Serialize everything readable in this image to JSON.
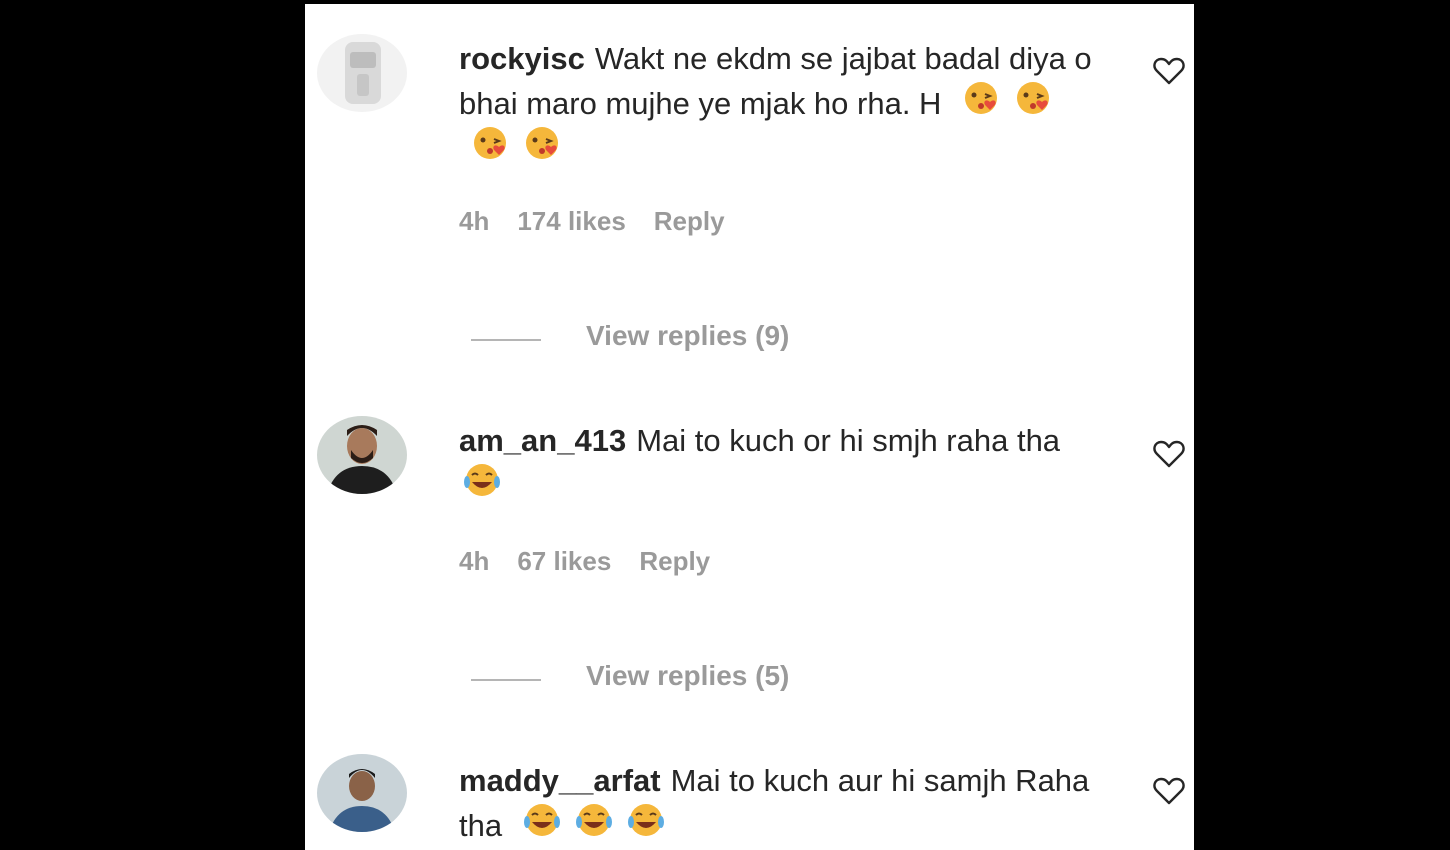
{
  "comments": [
    {
      "username": "rockyisc",
      "text": "Wakt ne ekdm se jajbat badal diya o bhai maro mujhe ye mjak ho rha. H",
      "emoji_count": 4,
      "emoji_type": "face-blowing-kiss",
      "time": "4h",
      "likes": "174 likes",
      "reply_label": "Reply",
      "view_replies": "View replies (9)"
    },
    {
      "username": "am_an_413",
      "text": "Mai to kuch or hi smjh raha tha",
      "emoji_count": 1,
      "emoji_type": "face-with-tears-of-joy",
      "time": "4h",
      "likes": "67 likes",
      "reply_label": "Reply",
      "view_replies": "View replies (5)"
    },
    {
      "username": "maddy__arfat",
      "text": "Mai to kuch aur hi samjh Raha tha",
      "emoji_count": 3,
      "emoji_type": "face-with-tears-of-joy"
    }
  ],
  "colors": {
    "background": "#000000",
    "panel": "#ffffff",
    "text": "#262626",
    "muted": "#9a9a9a"
  },
  "icons": {
    "like": "heart-icon"
  }
}
